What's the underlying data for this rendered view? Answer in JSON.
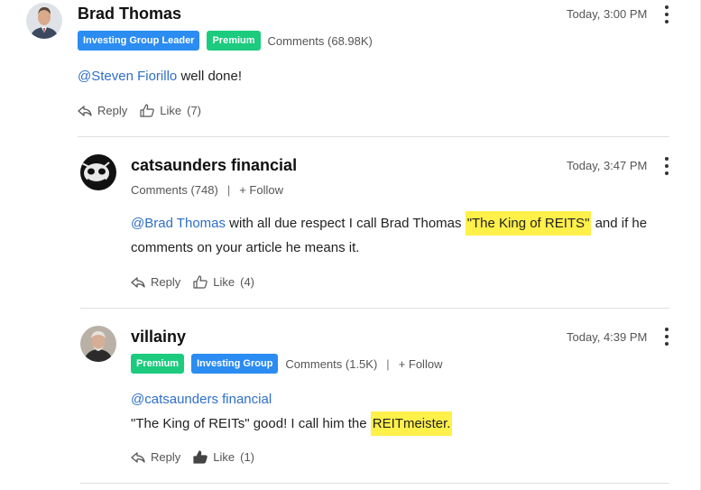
{
  "comments": [
    {
      "author": "Brad Thomas",
      "time": "Today, 3:00 PM",
      "badges": [
        "Investing Group Leader",
        "Premium"
      ],
      "comments_count": "Comments (68.98K)",
      "mention": "@Steven Fiorillo",
      "text": "well done!",
      "reply_label": "Reply",
      "like_label": "Like",
      "like_count": "(7)"
    },
    {
      "author": "catsaunders financial",
      "time": "Today, 3:47 PM",
      "comments_count": "Comments (748)",
      "separator": "|",
      "follow_label": "+ Follow",
      "mention": "@Brad Thomas",
      "text_part1": "with all due respect I call Brad Thomas",
      "highlight": "\"The King of REITS\"",
      "text_part2": "and if he",
      "text_line2": "comments on your article he means it.",
      "reply_label": "Reply",
      "like_label": "Like",
      "like_count": "(4)"
    },
    {
      "author": "villainy",
      "time": "Today, 4:39 PM",
      "badges": [
        "Premium",
        "Investing Group"
      ],
      "comments_count": "Comments (1.5K)",
      "separator": "|",
      "follow_label": "+ Follow",
      "mention": "@catsaunders financial",
      "text_part1": "\"The King of REITs\" good! I call him the",
      "highlight": "REITmeister.",
      "reply_label": "Reply",
      "like_label": "Like",
      "like_count": "(1)"
    }
  ],
  "colors": {
    "mention": "#2e6fc7",
    "badge_blue": "#2b8cf2",
    "badge_green": "#1ccb7e",
    "highlight": "#fff04a"
  },
  "icons": [
    "reply-icon",
    "thumbs-up-icon",
    "kebab-menu-icon"
  ]
}
